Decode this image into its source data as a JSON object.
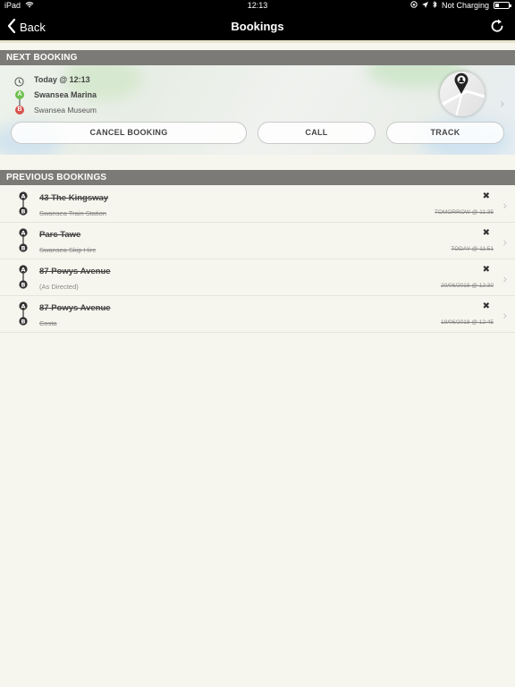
{
  "status_bar": {
    "device": "iPad",
    "time": "12:13",
    "charging": "Not Charging"
  },
  "nav": {
    "back_label": "Back",
    "title": "Bookings"
  },
  "next_booking": {
    "header": "NEXT BOOKING",
    "time": "Today @ 12:13",
    "pickup": "Swansea Marina",
    "dropoff": "Swansea Museum",
    "buttons": {
      "cancel": "CANCEL BOOKING",
      "call": "CALL",
      "track": "TRACK"
    }
  },
  "previous": {
    "header": "PREVIOUS BOOKINGS",
    "items": [
      {
        "from": "43 The Kingsway",
        "to": "Swansea Train Station",
        "date": "TOMORROW @ 11:35"
      },
      {
        "from": "Parc Tawe",
        "to": "Swansea Skip Hire",
        "date": "TODAY @ 11:51"
      },
      {
        "from": "87 Powys Avenue",
        "to": "(As Directed)",
        "date": "20/06/2018 @ 12:30"
      },
      {
        "from": "87 Powys Avenue",
        "to": "Costa",
        "date": "19/06/2018 @ 12:45"
      }
    ]
  },
  "colors": {
    "pickup_green": "#6cc04a",
    "dropoff_red": "#d9534f",
    "header_gray": "#7b7a77",
    "background": "#f7f6ee"
  }
}
